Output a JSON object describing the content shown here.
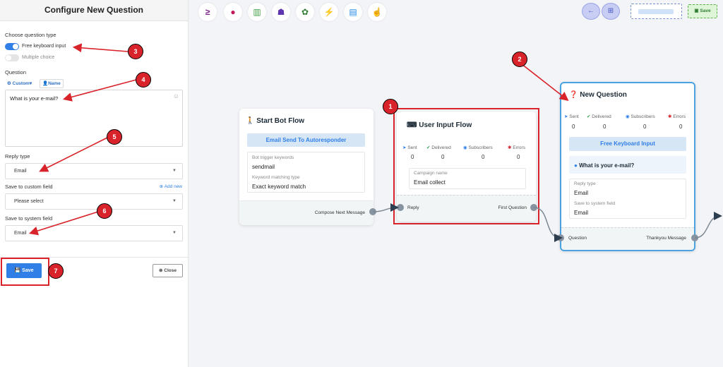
{
  "panel": {
    "title": "Configure New Question",
    "question_type_label": "Choose question type",
    "free_keyboard": "Free keyboard input",
    "multiple_choice": "Multiple choice",
    "question_label": "Question",
    "custom_chip": "Custom",
    "name_chip": "Name",
    "question_text": "What is your e-mail?",
    "reply_type_label": "Reply type",
    "reply_type_value": "Email",
    "custom_field_label": "Save to custom field",
    "add_new": "Add new",
    "custom_field_value": "Please select",
    "system_field_label": "Save to system field",
    "system_field_value": "Email",
    "save": "Save",
    "close": "Close"
  },
  "toolbar": {
    "save": "Save",
    "icons": [
      "chevron-right-underscore-icon",
      "drop-icon",
      "chart-icon",
      "robot-icon",
      "palette-icon",
      "plug-icon",
      "file-icon",
      "hand-pointer-icon"
    ]
  },
  "start_card": {
    "title": "Start Bot Flow",
    "button": "Email Send To Autoresponder",
    "trigger_label": "Bot trigger keywords",
    "trigger_value": "sendmail",
    "matching_label": "Keyword matching type",
    "matching_value": "Exact keyword match",
    "footer": "Compose Next Message"
  },
  "input_card": {
    "title": "User Input Flow",
    "stats": [
      "Sent",
      "Delivered",
      "Subscribers",
      "Errors"
    ],
    "values": [
      "0",
      "0",
      "0",
      "0"
    ],
    "campaign_label": "Campaign name",
    "campaign_value": "Email collect",
    "reply": "Reply",
    "first_question": "First Question"
  },
  "question_card": {
    "title": "New Question",
    "stats": [
      "Sent",
      "Delivered",
      "Subscribers",
      "Errors"
    ],
    "values": [
      "0",
      "0",
      "0",
      "0"
    ],
    "button": "Free Keyboard Input",
    "question": "What is your e-mail?",
    "reply_type_label": "Reply type",
    "reply_type_value": "Email",
    "system_field_label": "Save to system field",
    "system_field_value": "Email",
    "question_port": "Question",
    "thankyou": "Thankyou Message"
  },
  "badges": [
    "1",
    "2",
    "3",
    "4",
    "5",
    "6",
    "7"
  ],
  "colors": {
    "accent": "#2f7fe6",
    "annotation": "#d9232b"
  }
}
